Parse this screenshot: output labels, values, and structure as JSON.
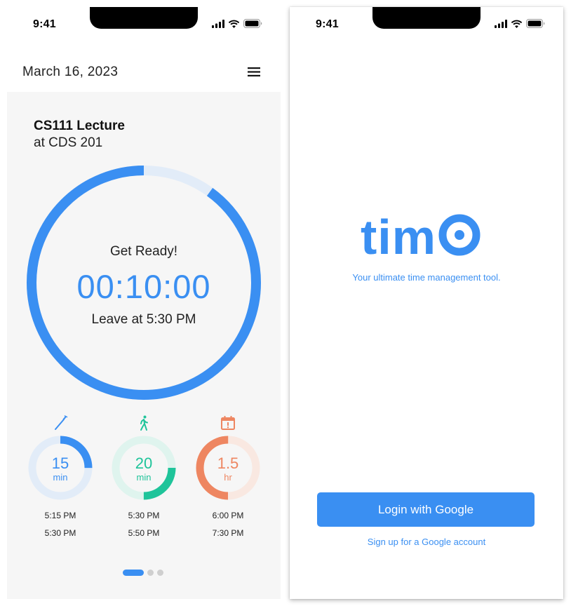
{
  "colors": {
    "blue": "#3a8ff2",
    "blue_track": "#e2ecf8",
    "green": "#1fc49a",
    "green_track": "#dff4ee",
    "orange": "#ee8661",
    "orange_track": "#f9e8e1"
  },
  "left_screen": {
    "status": {
      "time": "9:41",
      "icons": [
        "signal-icon",
        "wifi-icon",
        "battery-icon"
      ]
    },
    "header": {
      "date": "March 16, 2023",
      "menu_icon": "hamburger-menu-icon"
    },
    "event": {
      "title": "CS111 Lecture",
      "location": "at CDS 201"
    },
    "countdown": {
      "label": "Get Ready!",
      "timer": "00:10:00",
      "leave_text": "Leave at 5:30 PM",
      "progress_fraction": 0.9
    },
    "segments": [
      {
        "icon": "toothbrush-icon",
        "value": "15",
        "unit": "min",
        "start": "5:15 PM",
        "end": "5:30 PM",
        "progress_fraction": 0.25,
        "color": "blue"
      },
      {
        "icon": "walking-person-icon",
        "value": "20",
        "unit": "min",
        "start": "5:30 PM",
        "end": "5:50 PM",
        "progress_fraction": 0.25,
        "color": "green"
      },
      {
        "icon": "calendar-alert-icon",
        "value": "1.5",
        "unit": "hr",
        "start": "6:00 PM",
        "end": "7:30 PM",
        "progress_fraction": 0.5,
        "color": "orange"
      }
    ],
    "pager": {
      "count": 3,
      "active_index": 0
    }
  },
  "right_screen": {
    "status": {
      "time": "9:41",
      "icons": [
        "signal-icon",
        "wifi-icon",
        "battery-icon"
      ]
    },
    "logo_text": "timo",
    "tagline": "Your ultimate time management tool.",
    "login_button": "Login with Google",
    "signup_link": "Sign up for a Google account"
  }
}
